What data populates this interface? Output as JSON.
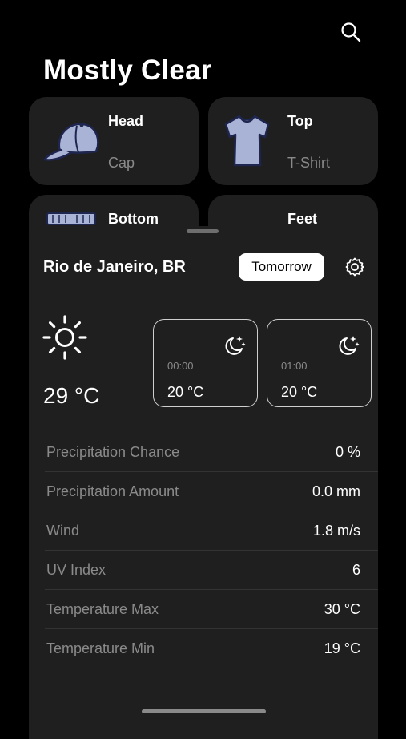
{
  "header": {
    "title": "Mostly Clear",
    "search_icon": "magnifying-glass-icon"
  },
  "outfit": {
    "head": {
      "label": "Head",
      "item": "Cap",
      "icon": "cap-icon"
    },
    "top": {
      "label": "Top",
      "item": "T-Shirt",
      "icon": "tshirt-icon"
    },
    "bottom": {
      "label": "Bottom",
      "icon": "shorts-icon"
    },
    "feet": {
      "label": "Feet"
    },
    "clothing_color": "#a9b3d6"
  },
  "sheet": {
    "location": "Rio de Janeiro, BR",
    "day_button": "Tomorrow",
    "settings_icon": "gear-icon",
    "current": {
      "icon": "sun-icon",
      "temperature": "29 °C"
    },
    "hourly": [
      {
        "time": "00:00",
        "temperature": "20 °C",
        "icon": "moon-stars-icon"
      },
      {
        "time": "01:00",
        "temperature": "20 °C",
        "icon": "moon-stars-icon"
      }
    ],
    "details": [
      {
        "label": "Precipitation Chance",
        "value": "0 %"
      },
      {
        "label": "Precipitation Amount",
        "value": "0.0 mm"
      },
      {
        "label": "Wind",
        "value": "1.8 m/s"
      },
      {
        "label": "UV Index",
        "value": "6"
      },
      {
        "label": "Temperature Max",
        "value": "30 °C"
      },
      {
        "label": "Temperature Min",
        "value": "19 °C"
      }
    ]
  }
}
